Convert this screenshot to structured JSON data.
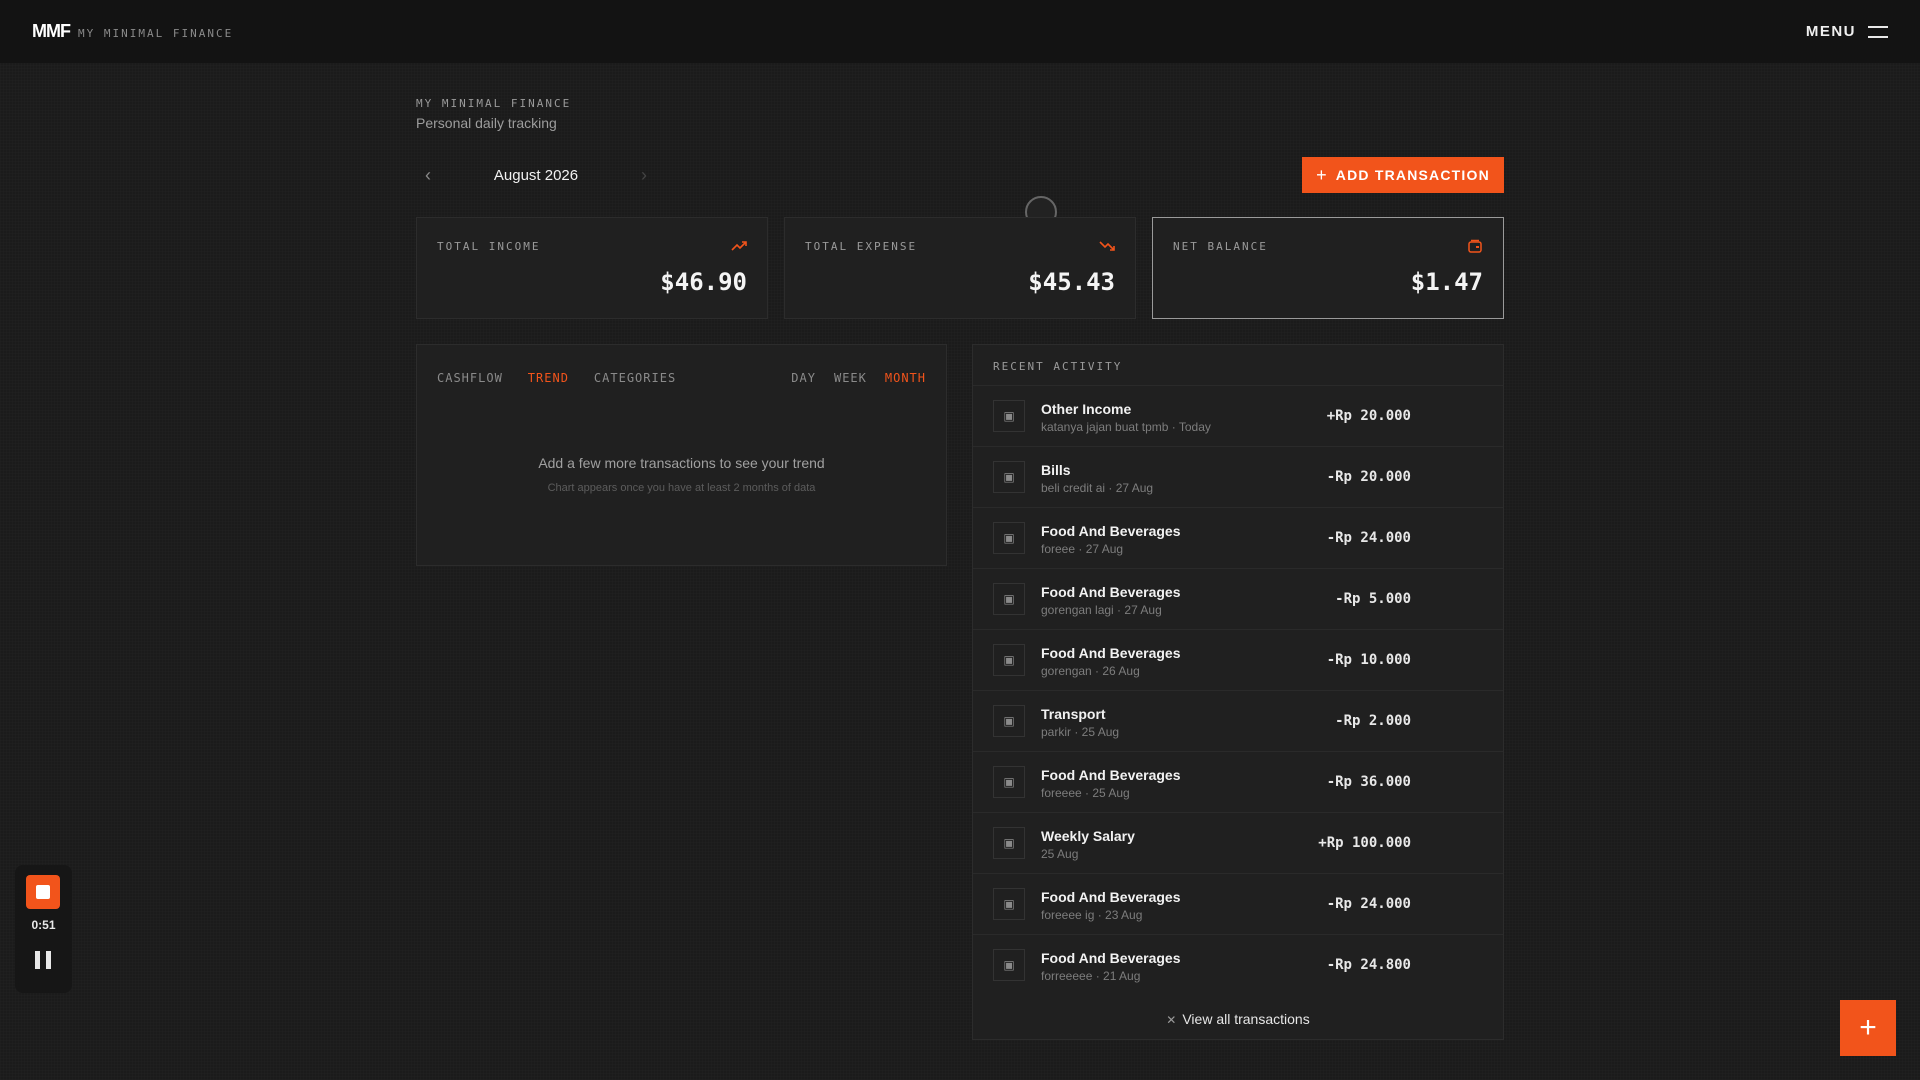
{
  "brand": {
    "logo": "MMF",
    "subtitle": "MY MINIMAL FINANCE"
  },
  "nav": {
    "menu_label": "MENU"
  },
  "header": {
    "eyebrow": "MY MINIMAL FINANCE",
    "subtitle": "Personal daily tracking"
  },
  "month_nav": {
    "label": "August 2026",
    "prev_icon": "chevron-left-icon",
    "next_icon": "chevron-right-icon"
  },
  "actions": {
    "add_transaction": "ADD TRANSACTION"
  },
  "stats": [
    {
      "label": "TOTAL INCOME",
      "value": "$46.90",
      "icon": "trending-up-icon"
    },
    {
      "label": "TOTAL EXPENSE",
      "value": "$45.43",
      "icon": "trending-down-icon"
    },
    {
      "label": "NET BALANCE",
      "value": "$1.47",
      "icon": "wallet-icon"
    }
  ],
  "cashflow": {
    "tabs": [
      "CASHFLOW",
      "TREND",
      "CATEGORIES"
    ],
    "active_tab": "TREND",
    "periods": [
      "DAY",
      "WEEK",
      "MONTH"
    ],
    "active_period": "MONTH",
    "empty_title": "Add a few more transactions to see your trend",
    "empty_subtitle": "Chart appears once you have at least 2 months of data"
  },
  "activity": {
    "title": "RECENT ACTIVITY",
    "rows": [
      {
        "title": "Other Income",
        "meta": "katanya jajan buat tpmb · Today",
        "amount": "+Rp 20.000"
      },
      {
        "title": "Bills",
        "meta": "beli credit ai · 27 Aug",
        "amount": "-Rp 20.000"
      },
      {
        "title": "Food And Beverages",
        "meta": "foreee · 27 Aug",
        "amount": "-Rp 24.000"
      },
      {
        "title": "Food And Beverages",
        "meta": "gorengan lagi · 27 Aug",
        "amount": "-Rp 5.000"
      },
      {
        "title": "Food And Beverages",
        "meta": "gorengan · 26 Aug",
        "amount": "-Rp 10.000"
      },
      {
        "title": "Transport",
        "meta": "parkir · 25 Aug",
        "amount": "-Rp 2.000"
      },
      {
        "title": "Food And Beverages",
        "meta": "foreeee · 25 Aug",
        "amount": "-Rp 36.000"
      },
      {
        "title": "Weekly Salary",
        "meta": "25 Aug",
        "amount": "+Rp 100.000"
      },
      {
        "title": "Food And Beverages",
        "meta": "foreeee ig · 23 Aug",
        "amount": "-Rp 24.000"
      },
      {
        "title": "Food And Beverages",
        "meta": "forreeeee · 21 Aug",
        "amount": "-Rp 24.800"
      }
    ],
    "view_all": "View all transactions"
  },
  "recorder": {
    "time": "0:51"
  },
  "colors": {
    "accent": "#f2541b",
    "background": "#1b1b1b",
    "panel": "#202020"
  }
}
